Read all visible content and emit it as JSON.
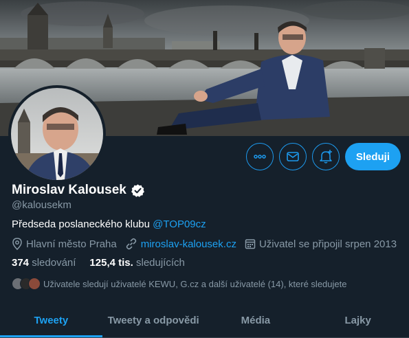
{
  "profile": {
    "name": "Miroslav Kalousek",
    "handle": "@kalousekm",
    "bio_text": "Předseda poslaneckého klubu ",
    "bio_mention": "@TOP09cz",
    "location": "Hlavní město Praha",
    "website": "miroslav-kalousek.cz",
    "joined": "Uživatel se připojil srpen 2013",
    "following_count": "374",
    "following_label": "sledování",
    "followers_count": "125,4 tis.",
    "followers_label": "sledujících",
    "followed_by_text": "Uživatele sledují uživatelé KEWU, G.cz a další uživatelé (14), které sledujete"
  },
  "actions": {
    "more_icon": "more-icon",
    "message_icon": "envelope-icon",
    "notify_icon": "bell-plus-icon",
    "follow_label": "Sleduji"
  },
  "tabs": [
    {
      "label": "Tweety",
      "active": true
    },
    {
      "label": "Tweety a odpovědi",
      "active": false
    },
    {
      "label": "Média",
      "active": false
    },
    {
      "label": "Lajky",
      "active": false
    }
  ],
  "colors": {
    "background": "#15202b",
    "accent": "#1da1f2",
    "muted": "#8899a6"
  }
}
